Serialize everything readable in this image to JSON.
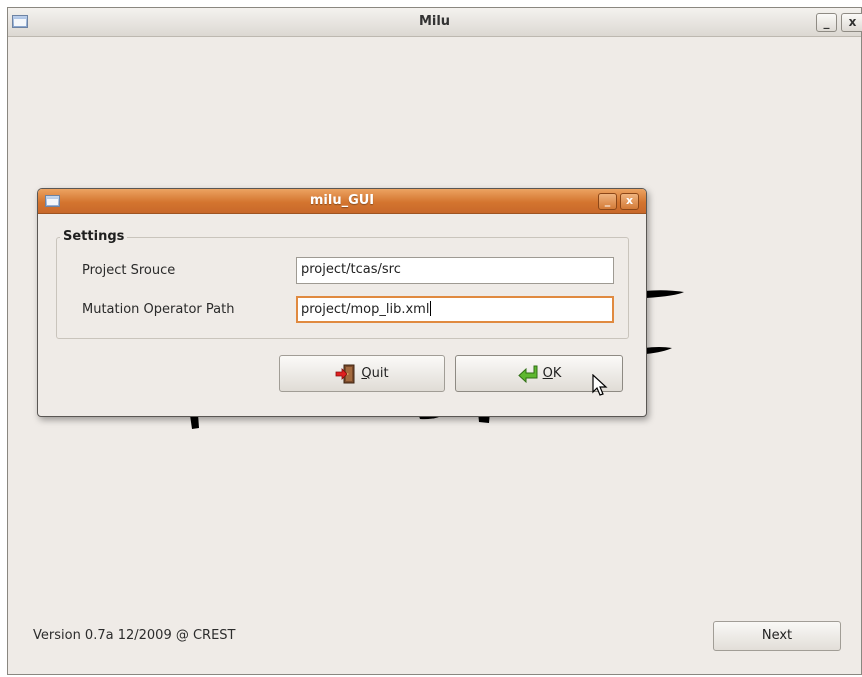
{
  "main_window": {
    "title": "Milu",
    "minimize_glyph": "_",
    "close_glyph": "x",
    "version_text": "Version 0.7a 12/2009 @ CREST",
    "next_label": "Next"
  },
  "dialog": {
    "title": "milu_GUI",
    "minimize_glyph": "_",
    "close_glyph": "x",
    "settings_legend": "Settings",
    "project_source_label": "Project Srouce",
    "project_source_value": "project/tcas/src",
    "mutation_operator_label": "Mutation Operator Path",
    "mutation_operator_value": "project/mop_lib.xml",
    "quit_mnemonic": "Q",
    "quit_rest": "uit",
    "ok_mnemonic": "O",
    "ok_rest": "K"
  },
  "icons": {
    "window_menu": "window-menu-icon",
    "quit": "quit-door-icon",
    "ok": "ok-arrow-icon",
    "cursor": "mouse-pointer-icon"
  },
  "colors": {
    "dialog_titlebar": "#d4752f",
    "focus_border": "#e08a40",
    "window_background": "#efebe7"
  }
}
